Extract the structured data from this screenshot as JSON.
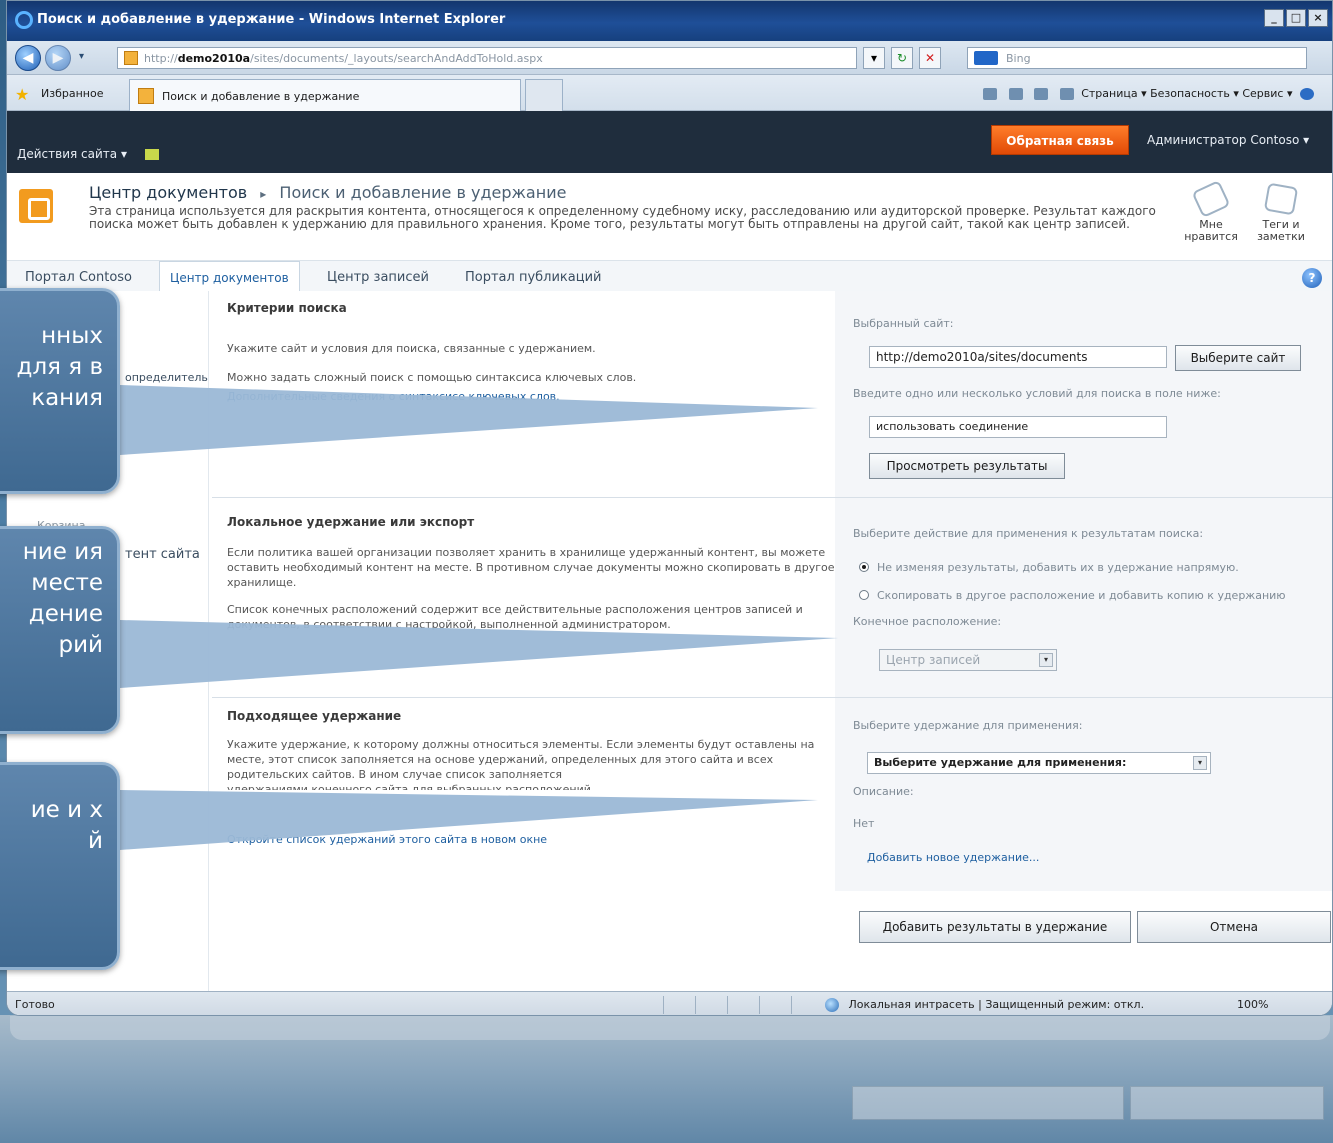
{
  "window": {
    "title": "Поиск и добавление в удержание - Windows Internet Explorer",
    "controls": [
      "_",
      "□",
      "×"
    ]
  },
  "addressbar": {
    "url_prefix": "http://",
    "url_host": "demo2010a",
    "url_path": "/sites/documents/_layouts/searchAndAddToHold.aspx",
    "search_placeholder": "Bing"
  },
  "favorites": {
    "label": "Избранное",
    "tab_title": "Поиск и добавление в удержание",
    "commands": "Страница ▾  Безопасность ▾  Сервис ▾"
  },
  "sp": {
    "site_actions": "Действия сайта ▾",
    "feedback": "Обратная связь",
    "user": "Администратор Contoso ▾",
    "breadcrumb_site": "Центр документов",
    "breadcrumb_sep": "▸",
    "breadcrumb_page": "Поиск и добавление в удержание",
    "description": "Эта страница используется для раскрытия контента, относящегося к определенному судебному иску, расследованию или аудиторской проверке. Результат каждого поиска может быть добавлен к удержанию для правильного хранения. Кроме того, результаты могут быть отправлены на другой сайт, такой как центр записей.",
    "like_label": "Мне нравится",
    "tags_label": "Теги и заметки"
  },
  "topnav": {
    "items": [
      "Портал Contoso",
      "Центр документов",
      "Центр записей",
      "Портал публикаций"
    ]
  },
  "leftnav": {
    "item1": "определитель",
    "item2": "Корзина",
    "item3": "тент сайта"
  },
  "search": {
    "title": "Критерии поиска",
    "p1": "Укажите сайт и условия для поиска, связанные с удержанием.",
    "p2": "Можно задать сложный поиск с помощью синтаксиса ключевых слов.",
    "link": "Дополнительные сведения о синтаксисе ключевых слов.",
    "site_label": "Выбранный сайт:",
    "site_value": "http://demo2010a/sites/documents",
    "choose_site": "Выберите сайт",
    "terms_label": "Введите одно или несколько условий для поиска в поле ниже:",
    "terms_value": "использовать соединение",
    "preview": "Просмотреть результаты"
  },
  "local": {
    "title": "Локальное удержание или экспорт",
    "p1": "Если политика вашей организации позволяет хранить в хранилище удержанный контент, вы можете оставить необходимый контент на месте. В противном случае документы можно скопировать в другое хранилище.",
    "p2": "Список конечных расположений содержит все действительные расположения центров записей и документов, в соответствии с настройкой, выполненной администратором.",
    "action_label": "Выберите действие для применения к результатам поиска:",
    "opt1": "Не изменяя результаты, добавить их в удержание напрямую.",
    "opt2": "Скопировать в другое расположение и добавить копию к удержанию",
    "dest_label": "Конечное расположение:",
    "dest_value": "Центр записей"
  },
  "hold": {
    "title": "Подходящее удержание",
    "p1": "Укажите удержание, к которому должны относиться элементы. Если элементы будут оставлены на месте, этот список заполняется на основе удержаний, определенных для этого сайта и всех родительских сайтов. В ином случае список заполняется",
    "p1b": "удержаниями конечного сайта для выбранных расположений.",
    "link": "Откройте список удержаний этого сайта в новом окне",
    "select_label": "Выберите удержание для применения:",
    "select_value": "Выберите удержание для применения:",
    "desc_label": "Описание:",
    "desc_value": "Нет",
    "add_link": "Добавить новое удержание..."
  },
  "actions": {
    "add": "Добавить результаты в удержание",
    "cancel": "Отмена"
  },
  "status": {
    "text": "Готово",
    "zone": "Локальная интрасеть | Защищенный режим: откл.",
    "zoom": "100%"
  },
  "callouts": {
    "c1": "нных для я в кания",
    "c2": "ние ия месте дение рий",
    "c3": "ие и х й"
  },
  "colors": {
    "feedback": "#e14a06",
    "title_bar": "#1f4f98",
    "ribbon": "#1f2d3d",
    "link": "#1e5fa0"
  }
}
